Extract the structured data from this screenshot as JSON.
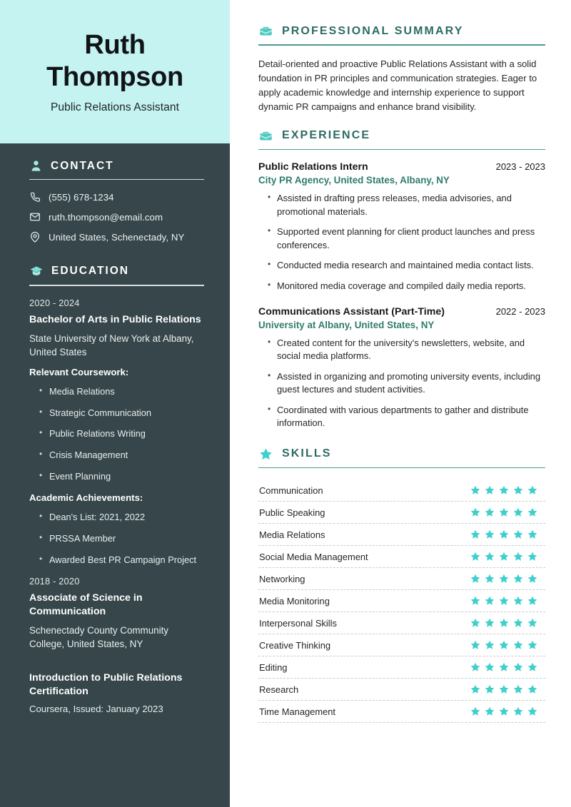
{
  "colors": {
    "header_bg": "#c4f3f1",
    "sidebar_bg": "#36464a",
    "heading_teal": "#2d6b63",
    "org_green": "#2f7d6b",
    "star_turquoise": "#3fd0cd",
    "icon_mint": "#a8e8e0"
  },
  "header": {
    "first_name": "Ruth",
    "last_name": "Thompson",
    "job_title": "Public Relations Assistant"
  },
  "contact": {
    "section_title": "CONTACT",
    "icon": "person-icon",
    "items": [
      {
        "icon": "phone-icon",
        "value": "(555) 678-1234"
      },
      {
        "icon": "email-icon",
        "value": "ruth.thompson@email.com"
      },
      {
        "icon": "location-icon",
        "value": "United States, Schenectady, NY"
      }
    ]
  },
  "education": {
    "section_title": "EDUCATION",
    "icon": "graduation-cap-icon",
    "entries": [
      {
        "dates": "2020 - 2024",
        "degree": "Bachelor of Arts in Public Relations",
        "school": "State University of New York at Albany, United States",
        "coursework_label": "Relevant Coursework:",
        "coursework": [
          "Media Relations",
          "Strategic Communication",
          "Public Relations Writing",
          "Crisis Management",
          "Event Planning"
        ],
        "achievements_label": "Academic Achievements:",
        "achievements": [
          "Dean's List: 2021, 2022",
          "PRSSA Member",
          "Awarded Best PR Campaign Project"
        ]
      },
      {
        "dates": "2018 - 2020",
        "degree": "Associate of Science in Communication",
        "school": "Schenectady County Community College, United States, NY"
      }
    ],
    "certification": {
      "title": "Introduction to Public Relations Certification",
      "meta": "Coursera, Issued: January 2023"
    }
  },
  "summary": {
    "section_title": "PROFESSIONAL SUMMARY",
    "icon": "briefcase-icon",
    "text": "Detail-oriented and proactive Public Relations Assistant with a solid foundation in PR principles and communication strategies. Eager to apply academic knowledge and internship experience to support dynamic PR campaigns and enhance brand visibility."
  },
  "experience": {
    "section_title": "EXPERIENCE",
    "icon": "briefcase-icon",
    "jobs": [
      {
        "role": "Public Relations Intern",
        "dates": "2023 - 2023",
        "organization": "City PR Agency, United States, Albany, NY",
        "bullets": [
          "Assisted in drafting press releases, media advisories, and promotional materials.",
          "Supported event planning for client product launches and press conferences.",
          "Conducted media research and maintained media contact lists.",
          "Monitored media coverage and compiled daily media reports."
        ]
      },
      {
        "role": "Communications Assistant (Part-Time)",
        "dates": "2022 - 2023",
        "organization": "University at Albany, United States, NY",
        "bullets": [
          "Created content for the university's newsletters, website, and social media platforms.",
          "Assisted in organizing and promoting university events, including guest lectures and student activities.",
          "Coordinated with various departments to gather and distribute information."
        ]
      }
    ]
  },
  "skills": {
    "section_title": "SKILLS",
    "icon": "star-icon",
    "max_rating": 5,
    "items": [
      {
        "name": "Communication",
        "rating": 5
      },
      {
        "name": "Public Speaking",
        "rating": 5
      },
      {
        "name": "Media Relations",
        "rating": 5
      },
      {
        "name": "Social Media Management",
        "rating": 5
      },
      {
        "name": "Networking",
        "rating": 5
      },
      {
        "name": "Media Monitoring",
        "rating": 5
      },
      {
        "name": "Interpersonal Skills",
        "rating": 5
      },
      {
        "name": "Creative Thinking",
        "rating": 5
      },
      {
        "name": "Editing",
        "rating": 5
      },
      {
        "name": "Research",
        "rating": 5
      },
      {
        "name": "Time Management",
        "rating": 5
      }
    ]
  }
}
